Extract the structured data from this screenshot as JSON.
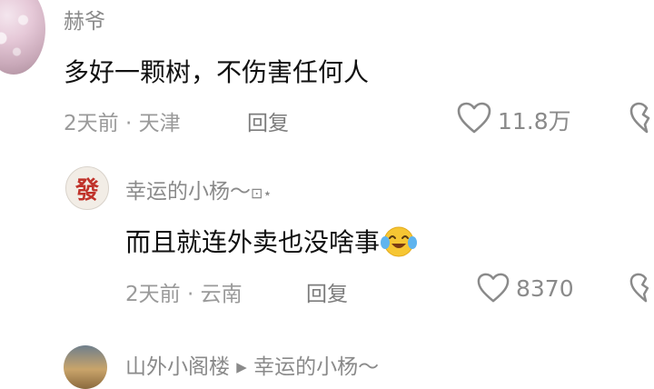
{
  "comment": {
    "username": "赫爷",
    "text": "多好一颗树，不伤害任何人",
    "meta": "2天前 · 天津",
    "reply_label": "回复",
    "like_count": "11.8万"
  },
  "reply": {
    "username": "幸运的小杨～",
    "username_suffix": "⊡⋆",
    "avatar_glyph": "發",
    "text": "而且就连外卖也没啥事",
    "meta": "2天前 · 云南",
    "reply_label": "回复",
    "like_count": "8370"
  },
  "next_reply": {
    "header": "山外小阁楼 ▸ 幸运的小杨～"
  },
  "icons": {
    "like": "heart-outline-icon",
    "dislike": "broken-heart-icon",
    "emoji": "tears-of-joy-emoji"
  },
  "colors": {
    "primary_text": "#111111",
    "secondary_text": "#8a8a8a",
    "avatar_glyph": "#c0332b"
  }
}
